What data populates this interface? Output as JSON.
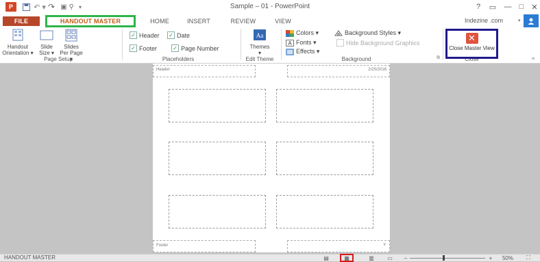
{
  "titlebar": {
    "app_logo": "P",
    "title": "Sample – 01 - PowerPoint",
    "quick_access": {
      "save_icon": "save-icon",
      "undo_icon": "undo-icon",
      "redo_icon": "redo-icon"
    },
    "controls": {
      "help": "?",
      "ribbon_display": "▭",
      "minimize": "—",
      "maximize": "□",
      "close": "✕"
    }
  },
  "tabs": {
    "file": "FILE",
    "handout_master": "HANDOUT MASTER",
    "home": "HOME",
    "insert": "INSERT",
    "review": "REVIEW",
    "view": "VIEW"
  },
  "account": {
    "name": "Indezine .com",
    "caret": "▾"
  },
  "ribbon": {
    "page_setup": {
      "handout_orientation": "Handout Orientation ▾",
      "slide_size": "Slide Size ▾",
      "slides_per_page": "Slides Per Page ▾",
      "label": "Page Setup"
    },
    "placeholders": {
      "header": "Header",
      "date": "Date",
      "footer": "Footer",
      "page_number": "Page Number",
      "label": "Placeholders"
    },
    "edit_theme": {
      "themes": "Themes",
      "label": "Edit Theme"
    },
    "background": {
      "colors": "Colors ▾",
      "fonts": "Fonts ▾",
      "effects": "Effects ▾",
      "background_styles": "Background Styles ▾",
      "hide_background_graphics": "Hide Background Graphics",
      "label": "Background"
    },
    "close": {
      "close_master_view": "Close Master View",
      "label": "Close"
    }
  },
  "page": {
    "header_text": "Header",
    "date_text": "2/25/2018",
    "footer_text": "Footer",
    "page_number_text": "#"
  },
  "status": {
    "label": "HANDOUT MASTER",
    "zoom": "50%"
  },
  "colors": {
    "accent": "#b7472a",
    "highlight_green": "#2fb44a",
    "highlight_blue": "#1f1a8c",
    "highlight_red": "#d61a1a"
  }
}
